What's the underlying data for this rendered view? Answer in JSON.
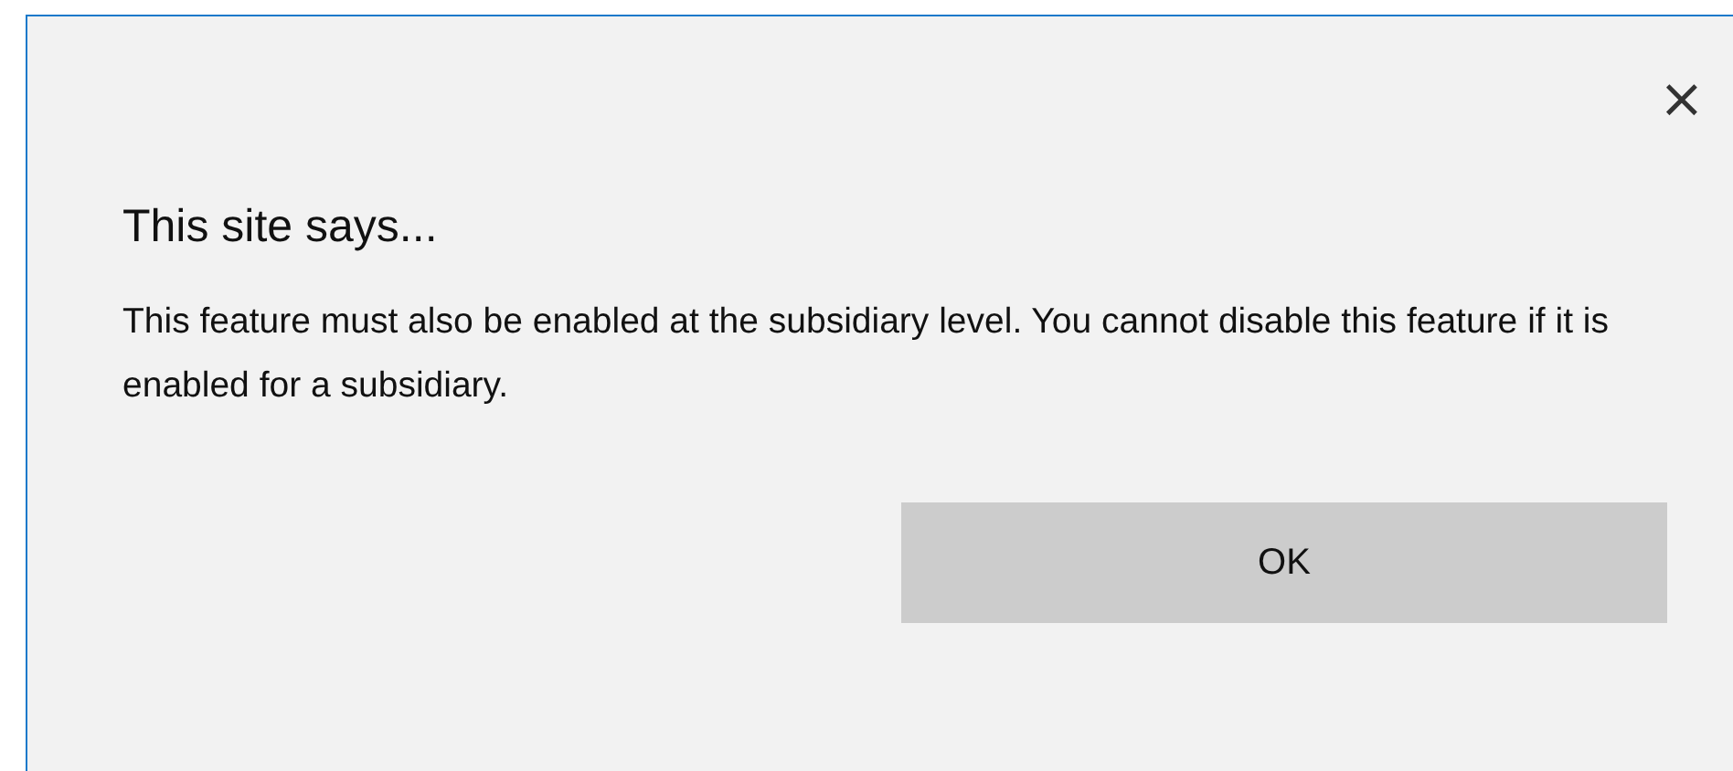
{
  "dialog": {
    "close": "×",
    "title": "This site says...",
    "message": "This feature must also be enabled at the subsidiary level. You cannot disable this feature if it is enabled for a subsidiary.",
    "buttons": [
      "OK"
    ]
  }
}
